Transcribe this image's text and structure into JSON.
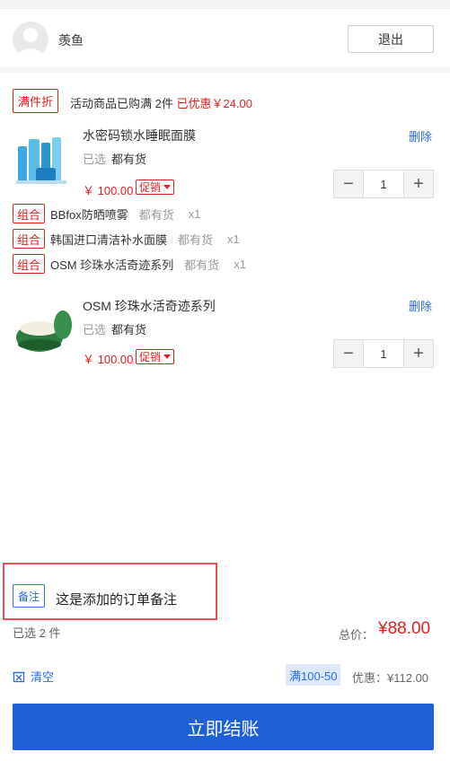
{
  "user": {
    "name": "羡鱼",
    "logout_label": "退出"
  },
  "promo": {
    "tag": "满件折",
    "text": "活动商品已购满 2件",
    "saved": "已优惠￥24.00"
  },
  "items": [
    {
      "name": "水密码锁水睡眠面膜",
      "delete_label": "删除",
      "selected_label": "已选",
      "stock": "都有货",
      "price": "￥ 100.00",
      "promo_label": "促销",
      "qty": "1",
      "combo": [
        {
          "tag": "组合",
          "name": "BBfox防晒喷雾",
          "stock": "都有货",
          "qty": "x1"
        },
        {
          "tag": "组合",
          "name": "韩国进口清洁补水面膜",
          "stock": "都有货",
          "qty": "x1"
        },
        {
          "tag": "组合",
          "name": "OSM 珍珠水活奇迹系列",
          "stock": "都有货",
          "qty": "x1"
        }
      ]
    },
    {
      "name": "OSM 珍珠水活奇迹系列",
      "delete_label": "删除",
      "selected_label": "已选",
      "stock": "都有货",
      "price": "￥ 100.00",
      "promo_label": "促销",
      "qty": "1"
    }
  ],
  "note": {
    "tag": "备注",
    "text": "这是添加的订单备注"
  },
  "summary": {
    "selected": "已选 2 件",
    "total_label": "总价：",
    "total_value": "¥88.00",
    "clear_label": "清空",
    "discount_tag": "满100-50",
    "discount_text": "优惠：¥112.00"
  },
  "checkout_label": "立即结账",
  "icons": {
    "avatar": "user-avatar-icon",
    "minus": "minus-icon",
    "plus": "plus-icon",
    "caret": "caret-down-icon",
    "clear": "clear-icon"
  },
  "colors": {
    "accent": "#1f5fd8",
    "price": "#e02020",
    "link": "#2d6be0",
    "note_highlight": "#ee4d56"
  }
}
